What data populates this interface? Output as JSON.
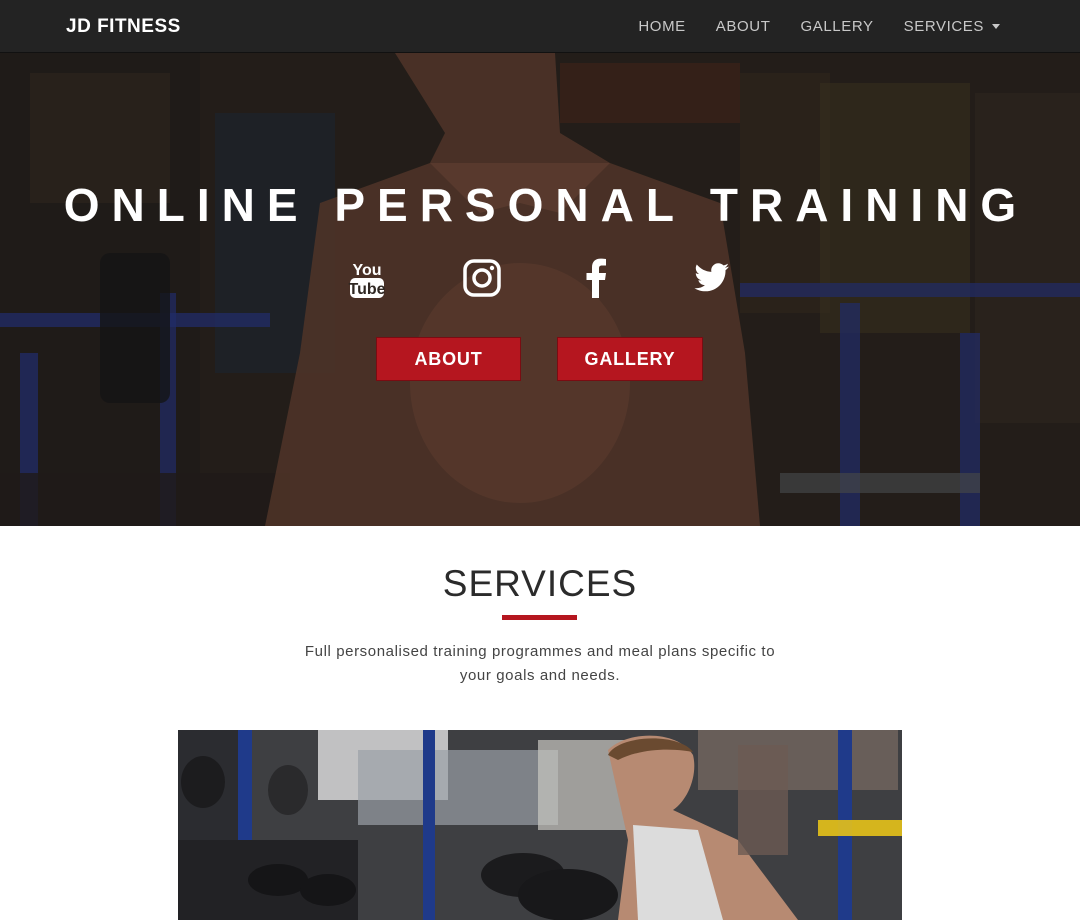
{
  "navbar": {
    "brand": "JD FITNESS",
    "links": [
      {
        "label": "HOME"
      },
      {
        "label": "ABOUT"
      },
      {
        "label": "GALLERY"
      },
      {
        "label": "SERVICES",
        "dropdown": true
      }
    ]
  },
  "hero": {
    "title": "ONLINE PERSONAL TRAINING",
    "social_icons": [
      "youtube-icon",
      "instagram-icon",
      "facebook-icon",
      "twitter-icon"
    ],
    "buttons": [
      {
        "label": "ABOUT"
      },
      {
        "label": "GALLERY"
      }
    ]
  },
  "services": {
    "title": "SERVICES",
    "text": "Full personalised training programmes and meal plans specific to your goals and needs."
  },
  "colors": {
    "accent": "#b5161f",
    "navbar_bg": "#232323",
    "nav_text": "#c8c8c8"
  }
}
